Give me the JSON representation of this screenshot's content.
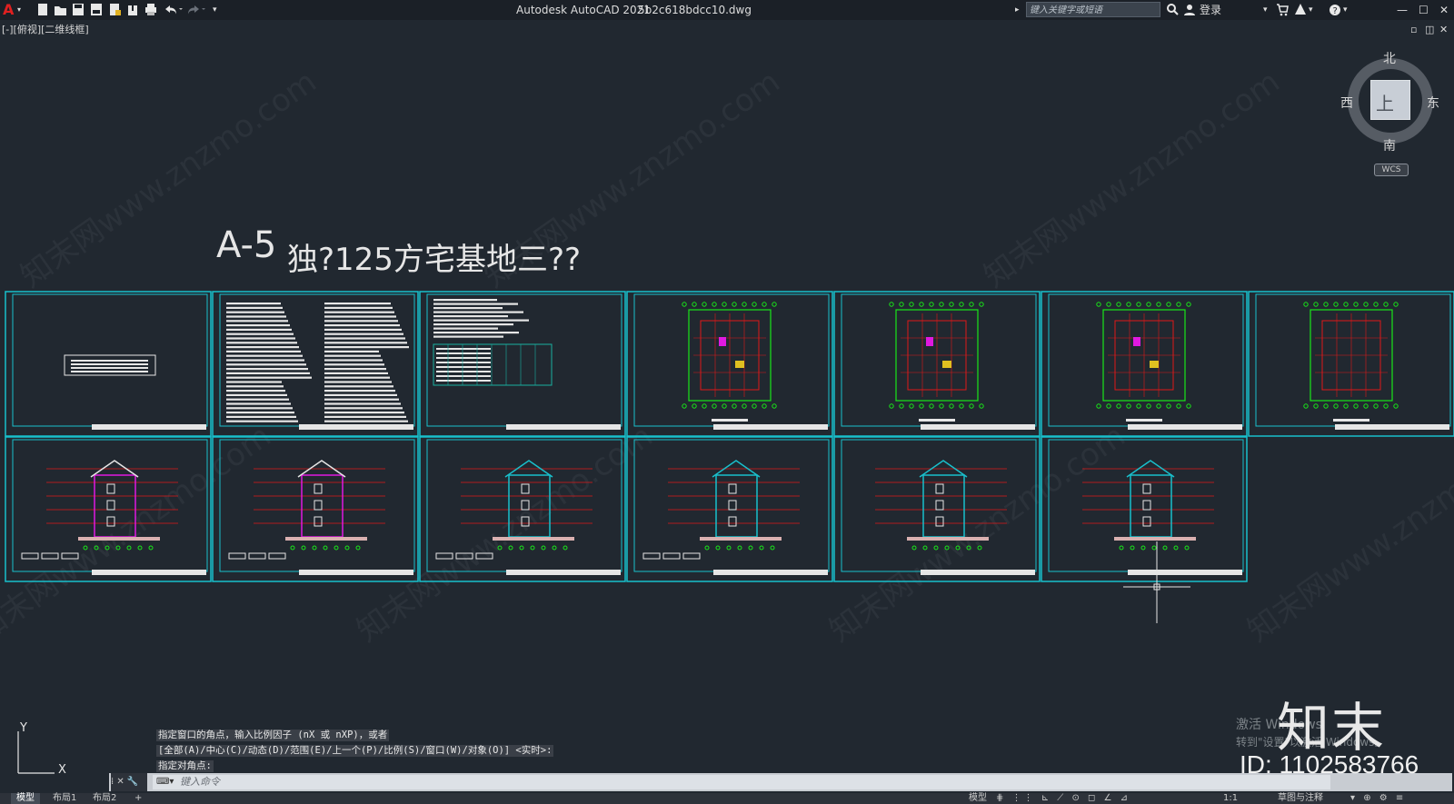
{
  "app": {
    "title": "Autodesk AutoCAD 2021",
    "filename": "5b2c618bdcc10.dwg",
    "logo": "A",
    "search_placeholder": "键入关键字或短语",
    "login": "登录"
  },
  "viewport": {
    "label": "[-][俯视][二维线框]"
  },
  "drawing": {
    "title_a": "A-5",
    "title_b": "独?125方宅基地三??"
  },
  "viewcube": {
    "north": "北",
    "south": "南",
    "west": "西",
    "east": "东",
    "face": "上",
    "wcs": "WCS"
  },
  "ucs": {
    "x": "X",
    "y": "Y"
  },
  "command": {
    "history": [
      "指定窗口的角点，输入比例因子 (nX 或 nXP)，或者",
      "[全部(A)/中心(C)/动态(D)/范围(E)/上一个(P)/比例(S)/窗口(W)/对象(O)] <实时>:",
      "指定对角点:"
    ],
    "placeholder": "键入命令"
  },
  "tabs": [
    "模型",
    "布局1",
    "布局2",
    "+"
  ],
  "status": {
    "model": "模型",
    "scale": "1:1",
    "annotate": "草图与注释"
  },
  "overlay": {
    "activate_title": "激活 Windows",
    "activate_sub": "转到\"设置\"以激活 Windows。",
    "brand": "知末",
    "id": "ID: 1102583766",
    "watermark": "知末网www.znzmo.com"
  },
  "colors": {
    "background": "#212830",
    "sheet_border": "#19c0cc",
    "plan_lines": "#19e619",
    "red": "#e01818",
    "magenta": "#e019e0"
  }
}
